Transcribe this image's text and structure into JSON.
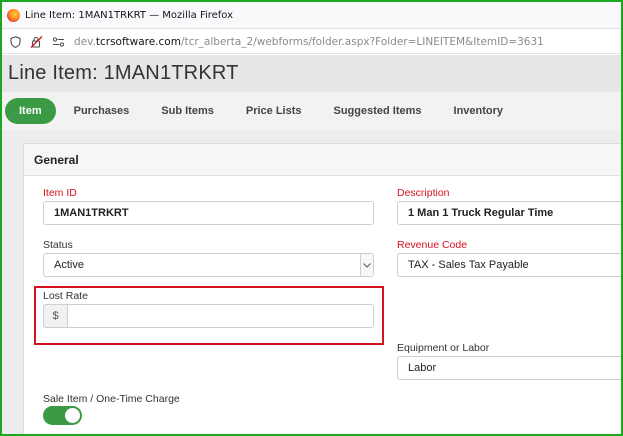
{
  "browser": {
    "window_title": "Line Item: 1MAN1TRKRT — Mozilla Firefox",
    "url_prefix": "dev.",
    "url_domain": "tcrsoftware.com",
    "url_path": "/tcr_alberta_2/webforms/folder.aspx?Folder=LINEITEM&ItemID=3631"
  },
  "page": {
    "title": "Line Item: 1MAN1TRKRT"
  },
  "tabs": [
    {
      "label": "Item",
      "active": true
    },
    {
      "label": "Purchases"
    },
    {
      "label": "Sub Items"
    },
    {
      "label": "Price Lists"
    },
    {
      "label": "Suggested Items"
    },
    {
      "label": "Inventory"
    }
  ],
  "section": {
    "title": "General"
  },
  "form": {
    "item_id": {
      "label": "Item ID",
      "value": "1MAN1TRKRT"
    },
    "description": {
      "label": "Description",
      "value": "1 Man 1 Truck Regular Time"
    },
    "status": {
      "label": "Status",
      "value": "Active"
    },
    "revenue_code": {
      "label": "Revenue Code",
      "value": "TAX - Sales Tax Payable"
    },
    "lost_rate": {
      "label": "Lost Rate",
      "prefix": "$",
      "value": ""
    },
    "equipment_or_labor": {
      "label": "Equipment or Labor",
      "value": "Labor"
    },
    "sale_item": {
      "label": "Sale Item / One-Time Charge",
      "on": true
    }
  },
  "colors": {
    "accent_green": "#3a9a46",
    "required_red": "#d6101f",
    "highlight_red": "#d6101f",
    "frame_green": "#19a81f"
  }
}
